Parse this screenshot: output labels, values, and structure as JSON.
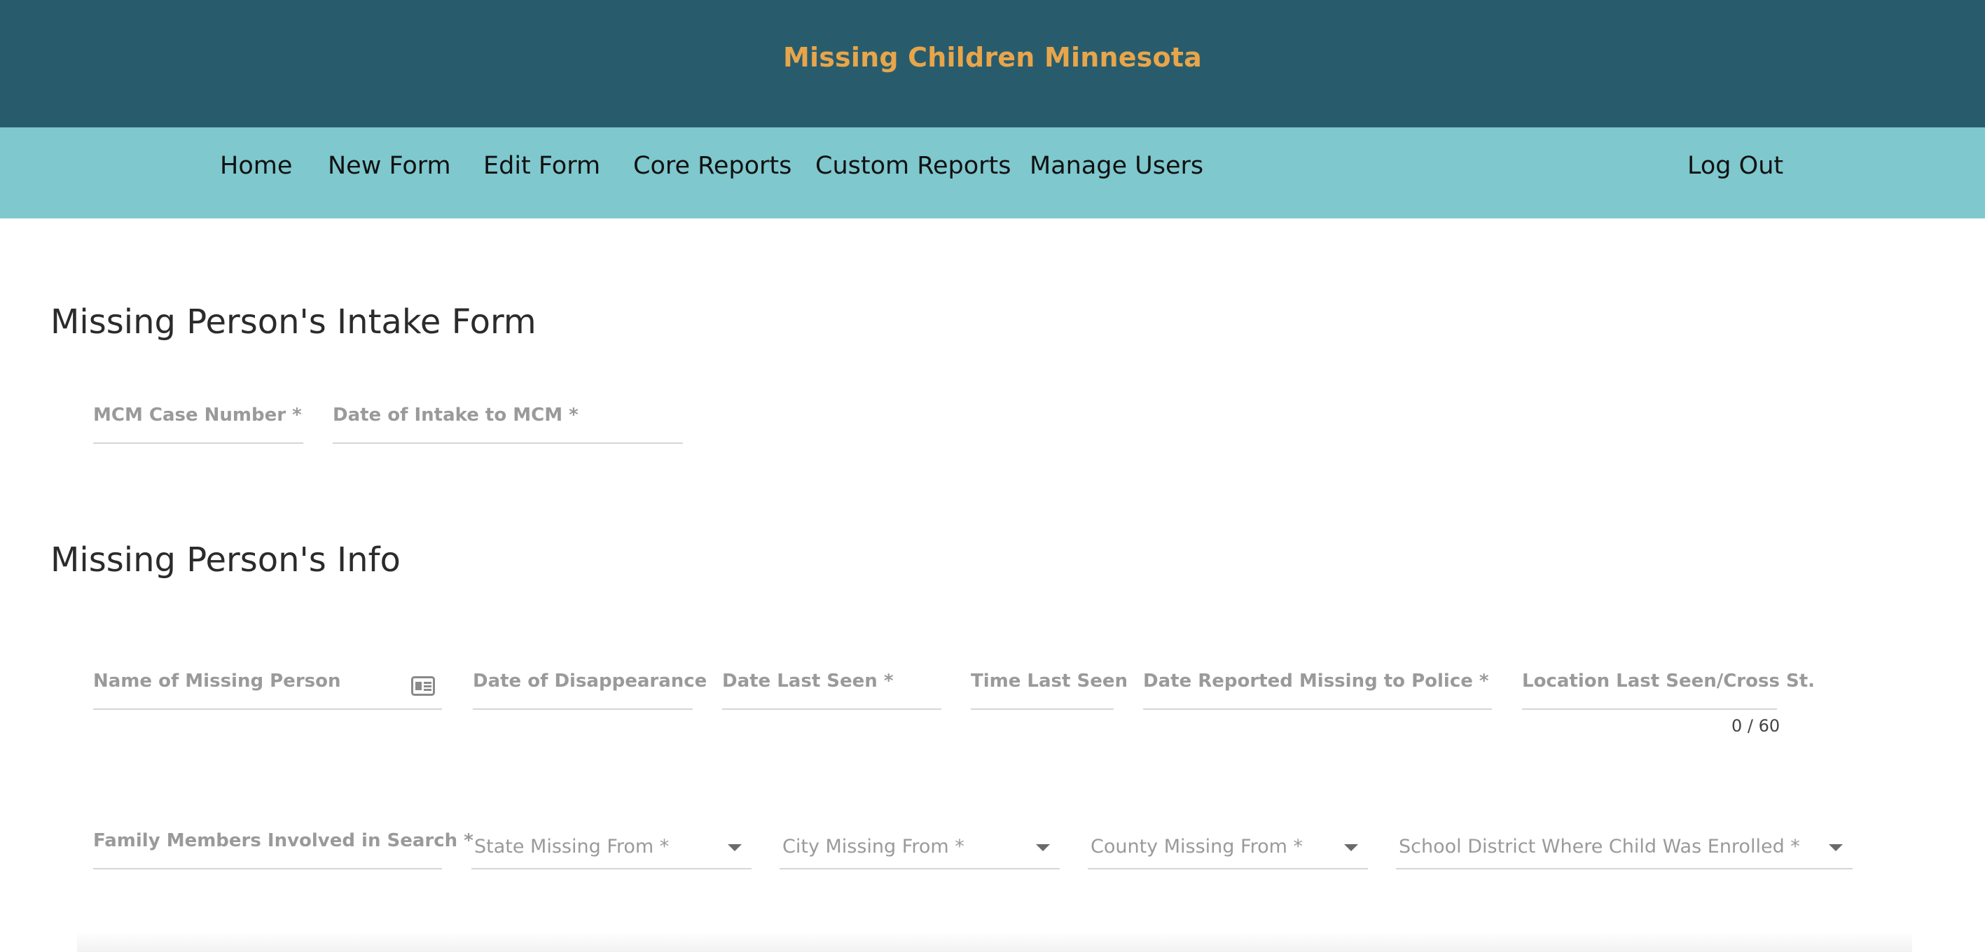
{
  "header": {
    "app_title": "Missing Children Minnesota"
  },
  "nav": {
    "items": [
      "Home",
      "New Form",
      "Edit Form",
      "Core Reports",
      "Custom Reports",
      "Manage Users"
    ],
    "logout": "Log Out"
  },
  "intake_section": {
    "title": "Missing Person's Intake Form",
    "fields": {
      "case_number": {
        "label": "MCM Case Number *",
        "value": ""
      },
      "intake_date": {
        "label": "Date of Intake to MCM *",
        "value": ""
      }
    }
  },
  "info_section": {
    "title": "Missing Person's Info",
    "fields": {
      "name": {
        "label": "Name of Missing Person",
        "value": ""
      },
      "disappearance_date": {
        "label": "Date of Disappearance",
        "value": ""
      },
      "date_last_seen": {
        "label": "Date Last Seen *",
        "value": ""
      },
      "time_last_seen": {
        "label": "Time Last Seen",
        "value": ""
      },
      "date_reported": {
        "label": "Date Reported Missing to Police *",
        "value": ""
      },
      "location_last_seen": {
        "label": "Location Last Seen/Cross St.",
        "value": "",
        "counter": "0 / 60"
      },
      "family_members": {
        "label": "Family Members Involved in Search *",
        "value": ""
      },
      "state": {
        "label": "State Missing From *",
        "selected": ""
      },
      "city": {
        "label": "City Missing From *",
        "selected": ""
      },
      "county": {
        "label": "County Missing From *",
        "selected": ""
      },
      "school_district": {
        "label": "School District Where Child Was Enrolled *",
        "selected": ""
      }
    }
  },
  "icons": {
    "contact_card": "contact-card-icon",
    "dropdown": "caret-down-icon"
  },
  "colors": {
    "header_bg": "#285c6d",
    "nav_bg": "#7ec8ce",
    "title_accent": "#e8a54a"
  }
}
